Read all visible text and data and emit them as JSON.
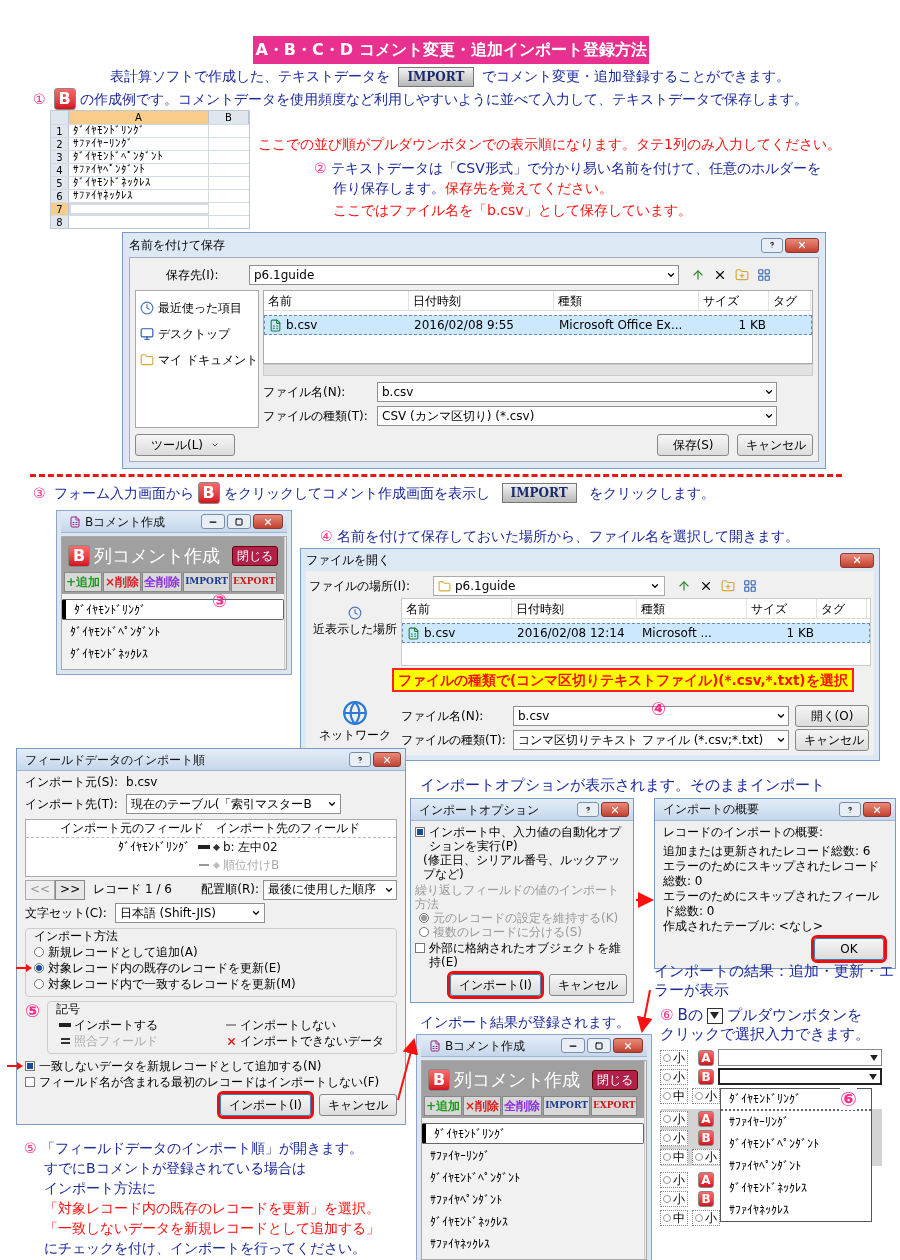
{
  "title": "A・B・C・D コメント変更・追加インポート登録方法",
  "intro": {
    "before": "表計算ソフトで作成した、テキストデータを",
    "badge": "IMPORT",
    "after": "でコメント変更・追加登録することができます。"
  },
  "step1": {
    "num": "①",
    "letter": "B",
    "text": "の作成例です。コメントデータを使用頻度など利用しやすいように並べて入力して、テキストデータで保存します。"
  },
  "sheet": {
    "columns": [
      {
        "label": "A",
        "selected": true
      },
      {
        "label": "B",
        "selected": false
      }
    ],
    "rows": [
      {
        "num": "1",
        "value": "ﾀﾞｲﾔﾓﾝﾄﾞﾘﾝｸﾞ",
        "selected": false
      },
      {
        "num": "2",
        "value": "ｻﾌｧｲﾔｰﾘﾝｸﾞ",
        "selected": false
      },
      {
        "num": "3",
        "value": "ﾀﾞｲﾔﾓﾝﾄﾞﾍﾟﾝﾀﾞﾝﾄ",
        "selected": false
      },
      {
        "num": "4",
        "value": "ｻﾌｧｲﾔﾍﾟﾝﾀﾞﾝﾄ",
        "selected": false
      },
      {
        "num": "5",
        "value": "ﾀﾞｲﾔﾓﾝﾄﾞﾈｯｸﾚｽ",
        "selected": false
      },
      {
        "num": "6",
        "value": "ｻﾌｧｲﾔﾈｯｸﾚｽ",
        "selected": false
      },
      {
        "num": "7",
        "selected": true
      },
      {
        "num": "8",
        "selected": false
      }
    ]
  },
  "order_note": "ここでの並び順がプルダウンボタンでの表示順になります。タテ1列のみ入力してください。",
  "step2": {
    "num": "②",
    "text_lines": [
      "テキストデータは「CSV形式」で分かり易い名前を付けて、任意のホルダーを",
      "作り保存します。"
    ],
    "warning": "保存先を覚えてください。",
    "note": "ここではファイル名を「b.csv」として保存しています。"
  },
  "save_dialog": {
    "title": "名前を付けて保存",
    "location_label": "保存先(I):",
    "location": "p6.1guide",
    "places": [
      {
        "label": "最近使った項目",
        "kind": "recent"
      },
      {
        "label": "デスクトップ",
        "kind": "desktop"
      },
      {
        "label": "マイ ドキュメント",
        "kind": "documents"
      }
    ],
    "columns": [
      "名前",
      "日付時刻",
      "種類",
      "サイズ",
      "タグ"
    ],
    "files": [
      {
        "name": "b.csv",
        "date": "2016/02/08 9:55",
        "type": "Microsoft Office Ex...",
        "size": "1 KB",
        "selected": true
      }
    ],
    "filename_label": "ファイル名(N):",
    "filename": "b.csv",
    "type_label": "ファイルの種類(T):",
    "type_value": "CSV (カンマ区切り) (*.csv)",
    "tools": "ツール(L)",
    "save": "保存(S)",
    "cancel": "キャンセル"
  },
  "step3": {
    "num": "③",
    "before": "フォーム入力画面から",
    "letter": "B",
    "middle": "をクリックしてコメント作成画面を表示し",
    "badge": "IMPORT",
    "after": "をクリックします。"
  },
  "comment_window": {
    "title": "Bコメント作成",
    "letter": "B",
    "heading": "列コメント作成",
    "close": "閉じる",
    "buttons": [
      {
        "label": "+追加",
        "color": "#1a9a1a"
      },
      {
        "label": "×削除",
        "color": "#d42020"
      },
      {
        "label": "全削除",
        "color": "#8a2be2"
      },
      {
        "label": "IMPORT",
        "color": "#1a3a8a"
      },
      {
        "label": "EXPORT",
        "color": "#cc1818"
      }
    ],
    "items": [
      {
        "label": "ﾀﾞｲﾔﾓﾝﾄﾞﾘﾝｸﾞ",
        "selected": true
      },
      {
        "label": "ﾀﾞｲﾔﾓﾝﾄﾞﾍﾟﾝﾀﾞﾝﾄ",
        "selected": false
      },
      {
        "label": "ﾀﾞｲﾔﾓﾝﾄﾞﾈｯｸﾚｽ",
        "selected": false
      }
    ],
    "callout": "③"
  },
  "step4": {
    "num": "④",
    "text": "名前を付けて保存しておいた場所から、ファイル名を選択して開きます。"
  },
  "open_dialog": {
    "title": "ファイルを開く",
    "location_label": "ファイルの場所(I):",
    "location": "p6.1guide",
    "places": [
      {
        "label": "近表示した場所",
        "kind": "recent"
      },
      {
        "label": "ネットワーク",
        "kind": "network"
      }
    ],
    "columns": [
      "名前",
      "日付時刻",
      "種類",
      "サイズ",
      "タグ"
    ],
    "files": [
      {
        "name": "b.csv",
        "date": "2016/02/08 12:14",
        "type": "Microsoft ...",
        "size": "1 KB",
        "selected": true
      }
    ],
    "banner": "ファイルの種類で(コンマ区切りテキストファイル)(*.csv,*.txt)を選択",
    "filename_label": "ファイル名(N):",
    "filename": "b.csv",
    "type_label": "ファイルの種類(T):",
    "type_value": "コンマ区切りテキスト ファイル (*.csv;*.txt)",
    "open": "開く(O)",
    "cancel": "キャンセル",
    "callout": "④"
  },
  "import_order": {
    "title": "フィールドデータのインポート順",
    "source_label": "インポート元(S):",
    "source": "b.csv",
    "target_label": "インポート先(T):",
    "target": "現在のテーブル(「索引マスターB",
    "columns": [
      "インポート元のフィールド",
      "インポート先のフィールド"
    ],
    "mappings": [
      {
        "source": "ﾀﾞｲﾔﾓﾝﾄﾞﾘﾝｸﾞ",
        "kind": "import",
        "target": "b: 左中02"
      },
      {
        "kind": "skip",
        "target": "順位付けB"
      }
    ],
    "prev": "<<",
    "next": ">>",
    "record": "レコード 1 / 6",
    "order_label": "配置順(R):",
    "order": "最後に使用した順序",
    "charset_label": "文字セット(C):",
    "charset": "日本語 (Shift-JIS)",
    "method_title": "インポート方法",
    "methods": [
      {
        "label": "新規レコードとして追加(A)",
        "selected": false
      },
      {
        "label": "対象レコード内の既存のレコードを更新(E)",
        "selected": true
      },
      {
        "label": "対象レコード内で一致するレコードを更新(M)",
        "selected": false
      }
    ],
    "legend_title": "記号",
    "legend": [
      {
        "label": "インポートする",
        "kind": "import"
      },
      {
        "label": "インポートしない",
        "kind": "skip"
      },
      {
        "label": "照合フィールド",
        "kind": "match"
      },
      {
        "label": "インポートできないデータ",
        "kind": "error"
      }
    ],
    "checks": [
      {
        "label": "一致しないデータを新規レコードとして追加する(N)",
        "checked": true
      },
      {
        "label": "フィールド名が含まれる最初のレコードはインポートしない(F)",
        "checked": false
      }
    ],
    "import": "インポート(I)",
    "cancel": "キャンセル",
    "callout": "⑤"
  },
  "options_caption": "インポートオプションが表示されます。そのままインポート",
  "options_dialog": {
    "title": "インポートオプション",
    "auto": {
      "label": "インポート中、入力値の自動化オプションを実行(P)",
      "checked": true
    },
    "hint": "(修正日、シリアル番号、ルックアップなど)",
    "repeat_title": "繰り返しフィールドの値のインポート方法",
    "repeat_options": [
      {
        "label": "元のレコードの設定を維持する(K)",
        "selected": true
      },
      {
        "label": "複数のレコードに分ける(S)",
        "selected": false
      }
    ],
    "external": {
      "label": "外部に格納されたオブジェクトを維持(E)",
      "checked": false
    },
    "import": "インポート(I)",
    "cancel": "キャンセル"
  },
  "summary_dialog": {
    "title": "インポートの概要",
    "lines": [
      "レコードのインポートの概要:",
      "追加または更新されたレコード総数: 6",
      "エラーのためにスキップされたレコード総数: 0",
      "エラーのためにスキップされたフィールド総数: 0",
      "作成されたテーブル: <なし>"
    ],
    "ok": "OK"
  },
  "result_caption": "インポートの結果：追加・更新・エラーが表示",
  "registered_caption": "インポート結果が登録されます。",
  "comment_window2": {
    "title": "Bコメント作成",
    "letter": "B",
    "heading": "列コメント作成",
    "close": "閉じる",
    "buttons": [
      {
        "label": "+追加",
        "color": "#1a9a1a"
      },
      {
        "label": "×削除",
        "color": "#d42020"
      },
      {
        "label": "全削除",
        "color": "#8a2be2"
      },
      {
        "label": "IMPORT",
        "color": "#1a3a8a"
      },
      {
        "label": "EXPORT",
        "color": "#cc1818"
      }
    ],
    "items": [
      {
        "label": "ﾀﾞｲﾔﾓﾝﾄﾞﾘﾝｸﾞ",
        "selected": true
      },
      {
        "label": "ｻﾌｧｲﾔｰﾘﾝｸﾞ",
        "selected": false
      },
      {
        "label": "ﾀﾞｲﾔﾓﾝﾄﾞﾍﾟﾝﾀﾞﾝﾄ",
        "selected": false
      },
      {
        "label": "ｻﾌｧｲﾔﾍﾟﾝﾀﾞﾝﾄ",
        "selected": false
      },
      {
        "label": "ﾀﾞｲﾔﾓﾝﾄﾞﾈｯｸﾚｽ",
        "selected": false
      },
      {
        "label": "ｻﾌｧｲﾔﾈｯｸﾚｽ",
        "selected": false
      }
    ]
  },
  "step6": {
    "num": "⑥",
    "before": "Bの",
    "after": "プルダウンボタンを",
    "line2": "クリックで選択入力できます。"
  },
  "form_preview": {
    "groups": [
      {
        "shaded": false,
        "rows": [
          {
            "kind": "field",
            "size": "小",
            "letter": "A",
            "open": false
          },
          {
            "kind": "field",
            "size": "小",
            "letter": "B",
            "open": true
          },
          {
            "kind": "sizes",
            "sizes": [
              "中",
              "小"
            ]
          }
        ]
      },
      {
        "shaded": true,
        "rows": [
          {
            "kind": "letter",
            "size": "小",
            "letter": "A"
          },
          {
            "kind": "letter",
            "size": "小",
            "letter": "B"
          },
          {
            "kind": "sizes",
            "sizes": [
              "中",
              "小"
            ]
          }
        ]
      },
      {
        "shaded": false,
        "rows": [
          {
            "kind": "letter",
            "size": "小",
            "letter": "A"
          },
          {
            "kind": "letter",
            "size": "小",
            "letter": "B"
          },
          {
            "kind": "sizes",
            "sizes": [
              "中",
              "小"
            ]
          }
        ]
      }
    ],
    "dropdown": [
      {
        "label": "ﾀﾞｲﾔﾓﾝﾄﾞﾘﾝｸﾞ",
        "selected": true
      },
      {
        "label": "ｻﾌｧｲﾔｰﾘﾝｸﾞ",
        "selected": false
      },
      {
        "label": "ﾀﾞｲﾔﾓﾝﾄﾞﾍﾟﾝﾀﾞﾝﾄ",
        "selected": false
      },
      {
        "label": "ｻﾌｧｲﾔﾍﾟﾝﾀﾞﾝﾄ",
        "selected": false
      },
      {
        "label": "ﾀﾞｲﾔﾓﾝﾄﾞﾈｯｸﾚｽ",
        "selected": false
      },
      {
        "label": "ｻﾌｧｲﾔﾈｯｸﾚｽ",
        "selected": false
      }
    ],
    "callout": "⑥"
  },
  "step5": {
    "num": "⑤",
    "lines": [
      {
        "text": "「フィールドデータのインポート順」が開きます。",
        "emphasis": false
      },
      {
        "text": "すでにBコメントが登録されている場合は",
        "emphasis": false
      },
      {
        "text": "インポート方法に",
        "emphasis": false
      },
      {
        "text": "「対象レコード内の既存のレコードを更新」を選択。",
        "emphasis": true
      },
      {
        "text": "「一致しないデータを新規レコードとして追加する」",
        "emphasis": true
      },
      {
        "text": "にチェックを付け、インポートを行ってください。",
        "emphasis": false
      }
    ]
  }
}
